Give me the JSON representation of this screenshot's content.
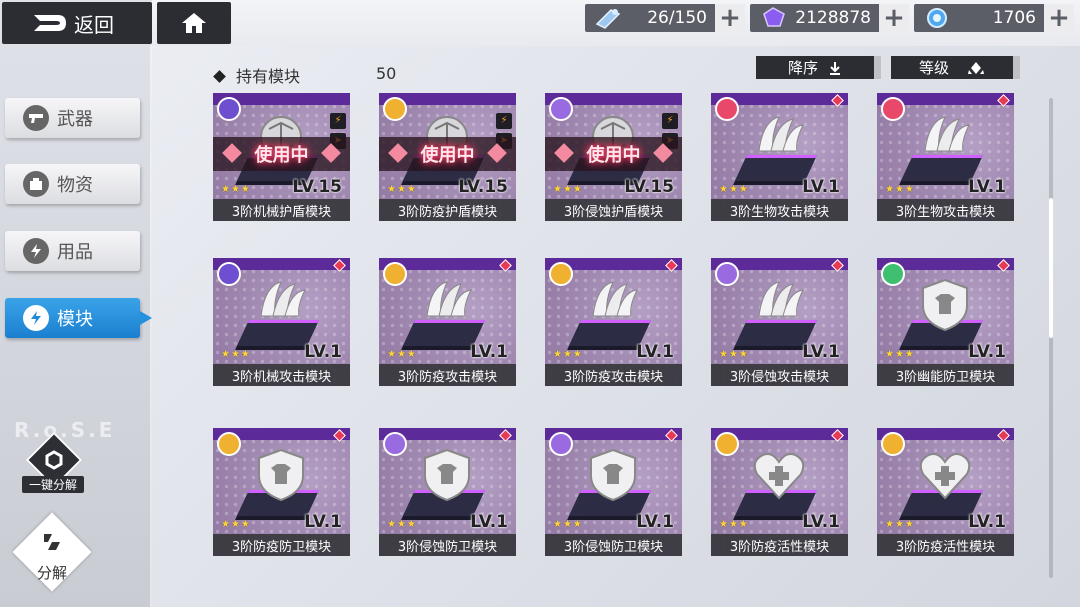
{
  "topbar": {
    "back_label": "返回",
    "resources": [
      {
        "icon": "stamina-icon",
        "value": "26/150",
        "plus": "+"
      },
      {
        "icon": "crystal-icon",
        "value": "2128878",
        "plus": "+"
      },
      {
        "icon": "orb-icon",
        "value": "1706",
        "plus": "+"
      }
    ]
  },
  "header": {
    "title": "持有模块",
    "count": "50",
    "sort_order_label": "降序",
    "sort_field_label": "等级"
  },
  "sidebar": {
    "items": [
      {
        "label": "武器",
        "icon": "gun-icon",
        "active": false
      },
      {
        "label": "物资",
        "icon": "crate-icon",
        "active": false
      },
      {
        "label": "用品",
        "icon": "bolt-icon",
        "active": false
      },
      {
        "label": "模块",
        "icon": "bolt-icon",
        "active": true
      }
    ],
    "watermark": "R.o.S.E",
    "oneclick_label": "一键分解",
    "decompose_label": "分解"
  },
  "colors": {
    "card_purple": "#5d2a9a",
    "active_blue": "#1f8ad8",
    "inuse_glow": "#ff3860"
  },
  "cards": [
    {
      "name": "3阶机械护盾模块",
      "level": "LV.15",
      "in_use": true,
      "in_use_label": "使用中",
      "element": "mechanical",
      "shape": "shield"
    },
    {
      "name": "3阶防疫护盾模块",
      "level": "LV.15",
      "in_use": true,
      "in_use_label": "使用中",
      "element": "immunity",
      "shape": "shield"
    },
    {
      "name": "3阶侵蚀护盾模块",
      "level": "LV.15",
      "in_use": true,
      "in_use_label": "使用中",
      "element": "erosion",
      "shape": "shield"
    },
    {
      "name": "3阶生物攻击模块",
      "level": "LV.1",
      "in_use": false,
      "element": "bio",
      "shape": "attack"
    },
    {
      "name": "3阶生物攻击模块",
      "level": "LV.1",
      "in_use": false,
      "element": "bio",
      "shape": "attack"
    },
    {
      "name": "3阶机械攻击模块",
      "level": "LV.1",
      "in_use": false,
      "element": "mechanical",
      "shape": "attack"
    },
    {
      "name": "3阶防疫攻击模块",
      "level": "LV.1",
      "in_use": false,
      "element": "immunity",
      "shape": "attack"
    },
    {
      "name": "3阶防疫攻击模块",
      "level": "LV.1",
      "in_use": false,
      "element": "immunity",
      "shape": "attack"
    },
    {
      "name": "3阶侵蚀攻击模块",
      "level": "LV.1",
      "in_use": false,
      "element": "erosion",
      "shape": "attack"
    },
    {
      "name": "3阶幽能防卫模块",
      "level": "LV.1",
      "in_use": false,
      "element": "psionic",
      "shape": "defense"
    },
    {
      "name": "3阶防疫防卫模块",
      "level": "LV.1",
      "in_use": false,
      "element": "immunity",
      "shape": "defense"
    },
    {
      "name": "3阶侵蚀防卫模块",
      "level": "LV.1",
      "in_use": false,
      "element": "erosion",
      "shape": "defense"
    },
    {
      "name": "3阶侵蚀防卫模块",
      "level": "LV.1",
      "in_use": false,
      "element": "erosion",
      "shape": "defense"
    },
    {
      "name": "3阶防疫活性模块",
      "level": "LV.1",
      "in_use": false,
      "element": "immunity",
      "shape": "vitality"
    },
    {
      "name": "3阶防疫活性模块",
      "level": "LV.1",
      "in_use": false,
      "element": "immunity",
      "shape": "vitality"
    }
  ]
}
